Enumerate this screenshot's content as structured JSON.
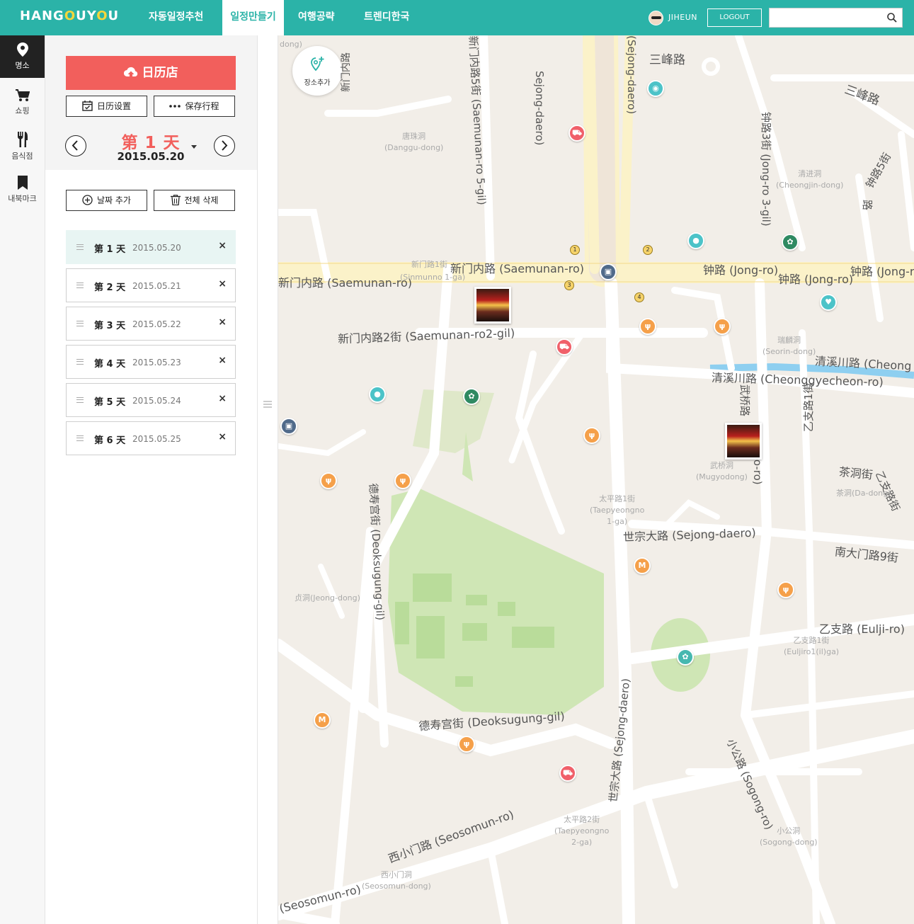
{
  "header": {
    "logo": {
      "h": "HANG",
      "o1": "O",
      "u": "U",
      "y": "Y",
      "o2": "O",
      "u2": "U"
    },
    "nav": [
      {
        "label": "자동일정추천"
      },
      {
        "label": "일정만들기",
        "active": true
      },
      {
        "label": "여행공략"
      },
      {
        "label": "트렌디한국"
      }
    ],
    "user_name": "JIHEUN",
    "logout_label": "LOGOUT",
    "search_value": "",
    "search_icon": "search-icon",
    "accent_color": "#2bb3a8"
  },
  "rail": [
    {
      "label": "명소",
      "icon": "map-pin-icon",
      "active": true
    },
    {
      "label": "쇼핑",
      "icon": "shopping-cart-icon"
    },
    {
      "label": "음식점",
      "icon": "utensils-icon"
    },
    {
      "label": "내북마크",
      "icon": "bookmark-icon"
    }
  ],
  "panel": {
    "calendar_button": "日历店",
    "calendar_settings": "日历设置",
    "save_schedule": "保存行程",
    "day_title": "第 1 天",
    "day_date": "2015.05.20",
    "add_date": "날짜 추가",
    "delete_all": "전체 삭제",
    "days": [
      {
        "label": "第 1 天",
        "date": "2015.05.20",
        "active": true
      },
      {
        "label": "第 2 天",
        "date": "2015.05.21"
      },
      {
        "label": "第 3 天",
        "date": "2015.05.22"
      },
      {
        "label": "第 4 天",
        "date": "2015.05.23"
      },
      {
        "label": "第 5 天",
        "date": "2015.05.24"
      },
      {
        "label": "第 6 天",
        "date": "2015.05.25"
      }
    ],
    "delete_mark": "×",
    "accent_color": "#f25f5c"
  },
  "map": {
    "add_place_label": "장소추가",
    "roads": {
      "samil": "三峰路",
      "samil2": "三峰路",
      "sejong_v1": "Sejong-daero)",
      "sejong_v2": "(Sejong-daero)",
      "saemunan": "新门内路 (Saemunan-ro)",
      "saemunan_left": "新门内路 (Saemunan-ro)",
      "sinmunno": "新门路1街",
      "sinmunno_en": "(Sinmunno 1-ga)",
      "jongro1": "钟路 (Jong-ro)",
      "jongro2": "钟路 (Jong-ro)",
      "jongro3": "钟路 (Jong-rc",
      "saemunan2": "新门内路2街 (Saemunan-ro2-gil)",
      "saemunan5": "新门内路5街 (Saemunan-ro 5-gil)",
      "saemunan_v": "新门内路",
      "jongro3gil": "钟路3街 (Jong-ro 3-gil)",
      "jongro5": "钟路5街",
      "cheonggyecheon": "清溪川路 (Cheonggyecheon-ro)",
      "cheonggye2": "清溪川路 (Cheong",
      "mugyo": "武桥路",
      "mugyo_en": "yo-ro)",
      "euljiro1": "乙支路1街",
      "dadong": "茶洞街",
      "euljiro_v": "乙支路街",
      "sejong_daero": "世宗大路 (Sejong-daero)",
      "sejong_diag": "世宗大路 (Sejong-daero)",
      "namdaemun": "南大门路9街",
      "euljiro": "乙支路 (Eulji-ro)",
      "deoksugung_v": "德寿宫街 (Deoksugung-gil)",
      "deoksugung_h": "德寿宫街 (Deoksugung-gil)",
      "seosomun": "西小门路 (Seosomun-ro)",
      "seosomun_left": "(Seosomun-ro)",
      "sogong": "小公路 (Sogong-ro)",
      "dong": "dong)",
      "jongro_v": "路"
    },
    "districts": [
      {
        "cn": "唐珠洞",
        "en": "(Danggu-dong)"
      },
      {
        "cn": "清进洞",
        "en": "(Cheongjin-dong)"
      },
      {
        "cn": "瑞麟洞",
        "en": "(Seorin-dong)"
      },
      {
        "cn": "武桥洞",
        "en": "(Mugyodong)"
      },
      {
        "cn": "茶洞",
        "en": "(Da-dong)"
      },
      {
        "cn": "太平路1街",
        "en": "(Taepyeongno",
        "en2": "1-ga)"
      },
      {
        "cn": "贞洞",
        "en": "(Jeong-dong)"
      },
      {
        "cn": "乙支路1街",
        "en": "(Euljiro1(il)ga)"
      },
      {
        "cn": "太平路2街",
        "en": "(Taepyeongno",
        "en2": "2-ga)"
      },
      {
        "cn": "小公洞",
        "en": "(Sogong-dong)"
      },
      {
        "cn": "西小门洞",
        "en": "(Seosomun-dong)"
      }
    ],
    "exits": [
      "1",
      "2",
      "3",
      "4"
    ],
    "poi_colors": {
      "food": "#f5a04a",
      "shop": "#f0606a",
      "place": "#4cc3c8",
      "starbucks": "#2f8a62",
      "bus": "#506a8a"
    }
  }
}
